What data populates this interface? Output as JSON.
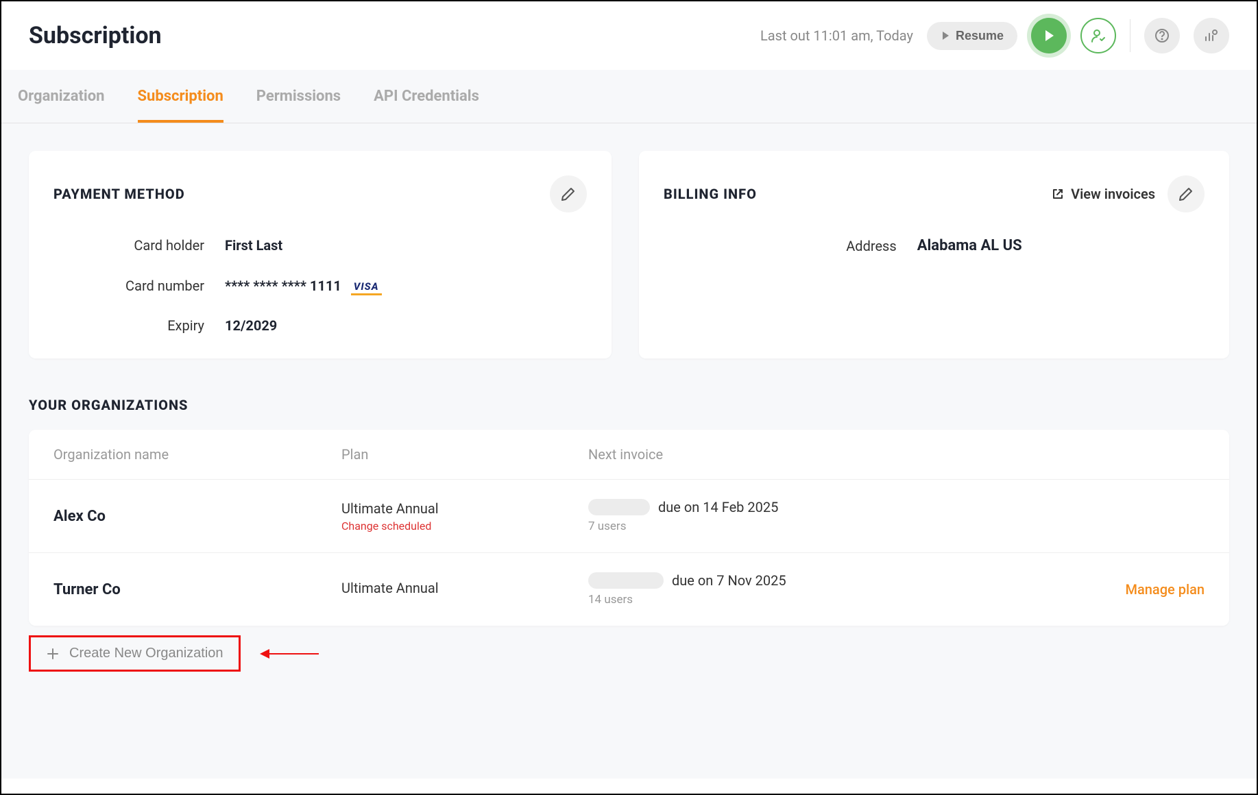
{
  "header": {
    "title": "Subscription",
    "status_text": "Last out 11:01 am, Today",
    "resume_label": "Resume"
  },
  "tabs": [
    {
      "label": "Organization",
      "active": false
    },
    {
      "label": "Subscription",
      "active": true
    },
    {
      "label": "Permissions",
      "active": false
    },
    {
      "label": "API Credentials",
      "active": false
    }
  ],
  "payment_method": {
    "title": "PAYMENT METHOD",
    "card_holder_label": "Card holder",
    "card_holder_value": "First Last",
    "card_number_label": "Card number",
    "card_number_value": "**** **** **** 1111",
    "card_brand": "VISA",
    "expiry_label": "Expiry",
    "expiry_value": "12/2029"
  },
  "billing_info": {
    "title": "BILLING INFO",
    "view_invoices_label": "View invoices",
    "address_label": "Address",
    "address_value": "Alabama AL US"
  },
  "organizations": {
    "section_title": "YOUR ORGANIZATIONS",
    "columns": {
      "name": "Organization name",
      "plan": "Plan",
      "next_invoice": "Next invoice"
    },
    "rows": [
      {
        "name": "Alex Co",
        "plan": "Ultimate Annual",
        "plan_note": "Change scheduled",
        "due_text": "due on 14 Feb 2025",
        "users": "7 users",
        "manage_label": ""
      },
      {
        "name": "Turner Co",
        "plan": "Ultimate Annual",
        "plan_note": "",
        "due_text": "due on 7 Nov 2025",
        "users": "14 users",
        "manage_label": "Manage plan"
      }
    ],
    "create_label": "Create New Organization"
  }
}
